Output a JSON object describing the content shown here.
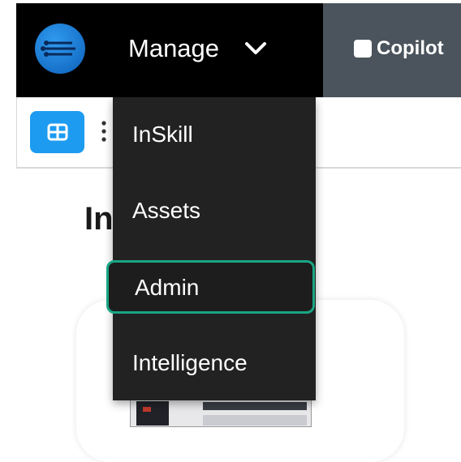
{
  "header": {
    "manage_label": "Manage",
    "copilot_label": "Copilot"
  },
  "page": {
    "heading_visible": "In                lots"
  },
  "menu": {
    "items": [
      {
        "label": "InSkill"
      },
      {
        "label": "Assets"
      },
      {
        "label": "Admin",
        "active": true
      },
      {
        "label": "Intelligence"
      }
    ]
  },
  "colors": {
    "topbar": "#000000",
    "menu_bg": "#222222",
    "active_outline": "#1aa584",
    "accent_blue": "#1d9bf0"
  },
  "icons": {
    "logo": "logo-icon",
    "chevron": "chevron-down-icon",
    "grid": "grid-view-icon",
    "kebab": "more-vertical-icon",
    "checkbox": "checkbox-icon"
  }
}
